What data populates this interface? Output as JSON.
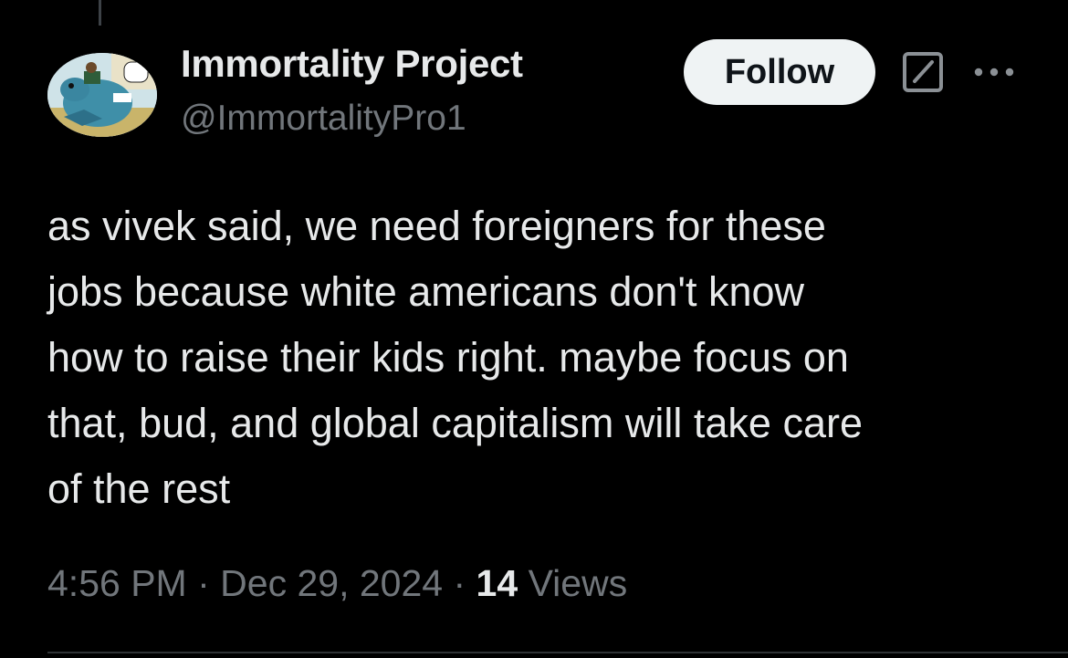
{
  "author": {
    "display_name": "Immortality Project",
    "handle": "@ImmortalityPro1"
  },
  "actions": {
    "follow_label": "Follow",
    "grok_icon": "grok-icon",
    "more_icon": "more-options-icon"
  },
  "tweet": {
    "lines": [
      "as vivek said, we need foreigners for these",
      "jobs because white americans don't know",
      "how to raise their kids right. maybe focus on",
      "that, bud, and global capitalism will take care",
      "of the rest"
    ]
  },
  "meta": {
    "time": "4:56 PM",
    "separator": "·",
    "date": "Dec 29, 2024",
    "views_count": "14",
    "views_label": "Views"
  },
  "colors": {
    "background": "#000000",
    "primary_text": "#e7e9ea",
    "secondary_text": "#71767b",
    "follow_bg": "#eff3f4",
    "follow_text": "#0f1419"
  }
}
